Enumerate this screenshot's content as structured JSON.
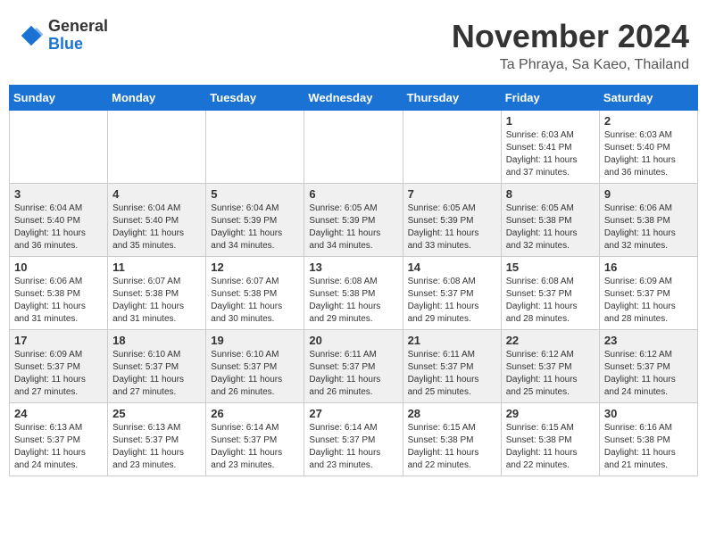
{
  "logo": {
    "general": "General",
    "blue": "Blue"
  },
  "header": {
    "month": "November 2024",
    "location": "Ta Phraya, Sa Kaeo, Thailand"
  },
  "weekdays": [
    "Sunday",
    "Monday",
    "Tuesday",
    "Wednesday",
    "Thursday",
    "Friday",
    "Saturday"
  ],
  "weeks": [
    [
      {
        "day": "",
        "info": ""
      },
      {
        "day": "",
        "info": ""
      },
      {
        "day": "",
        "info": ""
      },
      {
        "day": "",
        "info": ""
      },
      {
        "day": "",
        "info": ""
      },
      {
        "day": "1",
        "info": "Sunrise: 6:03 AM\nSunset: 5:41 PM\nDaylight: 11 hours and 37 minutes."
      },
      {
        "day": "2",
        "info": "Sunrise: 6:03 AM\nSunset: 5:40 PM\nDaylight: 11 hours and 36 minutes."
      }
    ],
    [
      {
        "day": "3",
        "info": "Sunrise: 6:04 AM\nSunset: 5:40 PM\nDaylight: 11 hours and 36 minutes."
      },
      {
        "day": "4",
        "info": "Sunrise: 6:04 AM\nSunset: 5:40 PM\nDaylight: 11 hours and 35 minutes."
      },
      {
        "day": "5",
        "info": "Sunrise: 6:04 AM\nSunset: 5:39 PM\nDaylight: 11 hours and 34 minutes."
      },
      {
        "day": "6",
        "info": "Sunrise: 6:05 AM\nSunset: 5:39 PM\nDaylight: 11 hours and 34 minutes."
      },
      {
        "day": "7",
        "info": "Sunrise: 6:05 AM\nSunset: 5:39 PM\nDaylight: 11 hours and 33 minutes."
      },
      {
        "day": "8",
        "info": "Sunrise: 6:05 AM\nSunset: 5:38 PM\nDaylight: 11 hours and 32 minutes."
      },
      {
        "day": "9",
        "info": "Sunrise: 6:06 AM\nSunset: 5:38 PM\nDaylight: 11 hours and 32 minutes."
      }
    ],
    [
      {
        "day": "10",
        "info": "Sunrise: 6:06 AM\nSunset: 5:38 PM\nDaylight: 11 hours and 31 minutes."
      },
      {
        "day": "11",
        "info": "Sunrise: 6:07 AM\nSunset: 5:38 PM\nDaylight: 11 hours and 31 minutes."
      },
      {
        "day": "12",
        "info": "Sunrise: 6:07 AM\nSunset: 5:38 PM\nDaylight: 11 hours and 30 minutes."
      },
      {
        "day": "13",
        "info": "Sunrise: 6:08 AM\nSunset: 5:38 PM\nDaylight: 11 hours and 29 minutes."
      },
      {
        "day": "14",
        "info": "Sunrise: 6:08 AM\nSunset: 5:37 PM\nDaylight: 11 hours and 29 minutes."
      },
      {
        "day": "15",
        "info": "Sunrise: 6:08 AM\nSunset: 5:37 PM\nDaylight: 11 hours and 28 minutes."
      },
      {
        "day": "16",
        "info": "Sunrise: 6:09 AM\nSunset: 5:37 PM\nDaylight: 11 hours and 28 minutes."
      }
    ],
    [
      {
        "day": "17",
        "info": "Sunrise: 6:09 AM\nSunset: 5:37 PM\nDaylight: 11 hours and 27 minutes."
      },
      {
        "day": "18",
        "info": "Sunrise: 6:10 AM\nSunset: 5:37 PM\nDaylight: 11 hours and 27 minutes."
      },
      {
        "day": "19",
        "info": "Sunrise: 6:10 AM\nSunset: 5:37 PM\nDaylight: 11 hours and 26 minutes."
      },
      {
        "day": "20",
        "info": "Sunrise: 6:11 AM\nSunset: 5:37 PM\nDaylight: 11 hours and 26 minutes."
      },
      {
        "day": "21",
        "info": "Sunrise: 6:11 AM\nSunset: 5:37 PM\nDaylight: 11 hours and 25 minutes."
      },
      {
        "day": "22",
        "info": "Sunrise: 6:12 AM\nSunset: 5:37 PM\nDaylight: 11 hours and 25 minutes."
      },
      {
        "day": "23",
        "info": "Sunrise: 6:12 AM\nSunset: 5:37 PM\nDaylight: 11 hours and 24 minutes."
      }
    ],
    [
      {
        "day": "24",
        "info": "Sunrise: 6:13 AM\nSunset: 5:37 PM\nDaylight: 11 hours and 24 minutes."
      },
      {
        "day": "25",
        "info": "Sunrise: 6:13 AM\nSunset: 5:37 PM\nDaylight: 11 hours and 23 minutes."
      },
      {
        "day": "26",
        "info": "Sunrise: 6:14 AM\nSunset: 5:37 PM\nDaylight: 11 hours and 23 minutes."
      },
      {
        "day": "27",
        "info": "Sunrise: 6:14 AM\nSunset: 5:37 PM\nDaylight: 11 hours and 23 minutes."
      },
      {
        "day": "28",
        "info": "Sunrise: 6:15 AM\nSunset: 5:38 PM\nDaylight: 11 hours and 22 minutes."
      },
      {
        "day": "29",
        "info": "Sunrise: 6:15 AM\nSunset: 5:38 PM\nDaylight: 11 hours and 22 minutes."
      },
      {
        "day": "30",
        "info": "Sunrise: 6:16 AM\nSunset: 5:38 PM\nDaylight: 11 hours and 21 minutes."
      }
    ]
  ]
}
